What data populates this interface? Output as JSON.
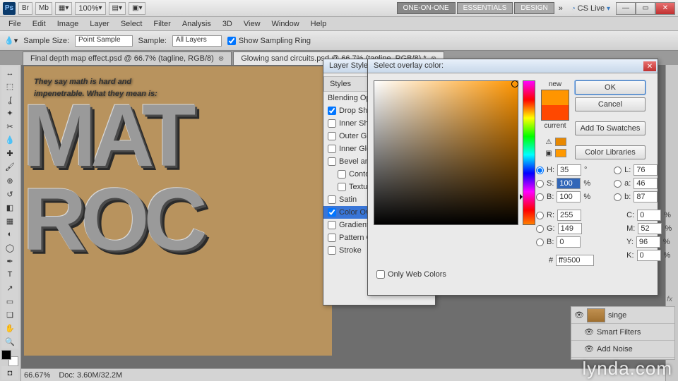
{
  "titlebar": {
    "zoom_display": "100%",
    "workspaces": [
      "ONE-ON-ONE",
      "ESSENTIALS",
      "DESIGN"
    ],
    "cslive": "CS Live"
  },
  "menu": [
    "File",
    "Edit",
    "Image",
    "Layer",
    "Select",
    "Filter",
    "Analysis",
    "3D",
    "View",
    "Window",
    "Help"
  ],
  "optionsbar": {
    "sample_size_label": "Sample Size:",
    "sample_size_value": "Point Sample",
    "sample_label": "Sample:",
    "sample_value": "All Layers",
    "show_ring_label": "Show Sampling Ring"
  },
  "tabs": [
    {
      "label": "Final depth map effect.psd @ 66.7% (tagline, RGB/8)",
      "active": false
    },
    {
      "label": "Glowing sand circuits.psd @ 66.7% (tagline, RGB/8) *",
      "active": true
    }
  ],
  "canvas": {
    "tagline_line1": "They say math is hard and",
    "tagline_line2": "impenetrable. What they mean is:",
    "big_row1": "MAT",
    "big_row2": "ROC"
  },
  "statusbar": {
    "zoom": "66.67%",
    "doc": "Doc: 3.60M/32.2M"
  },
  "layer_style": {
    "title": "Layer Style",
    "header": "Styles",
    "blending": "Blending Options",
    "items": [
      {
        "label": "Drop Shadow",
        "checked": true
      },
      {
        "label": "Inner Shadow",
        "checked": false
      },
      {
        "label": "Outer Glow",
        "checked": false
      },
      {
        "label": "Inner Glow",
        "checked": false
      },
      {
        "label": "Bevel and Emboss",
        "checked": false
      },
      {
        "label": "Contour",
        "checked": false,
        "sub": true
      },
      {
        "label": "Texture",
        "checked": false,
        "sub": true
      },
      {
        "label": "Satin",
        "checked": false
      },
      {
        "label": "Color Overlay",
        "checked": true,
        "selected": true
      },
      {
        "label": "Gradient Overlay",
        "checked": false
      },
      {
        "label": "Pattern Overlay",
        "checked": false
      },
      {
        "label": "Stroke",
        "checked": false
      }
    ]
  },
  "color_picker": {
    "title": "Select overlay color:",
    "new_label": "new",
    "current_label": "current",
    "buttons": {
      "ok": "OK",
      "cancel": "Cancel",
      "add": "Add To Swatches",
      "lib": "Color Libraries"
    },
    "web_only": "Only Web Colors",
    "H": {
      "label": "H:",
      "value": "35",
      "unit": "°"
    },
    "S": {
      "label": "S:",
      "value": "100",
      "unit": "%"
    },
    "B": {
      "label": "B:",
      "value": "100",
      "unit": "%"
    },
    "R": {
      "label": "R:",
      "value": "255"
    },
    "G": {
      "label": "G:",
      "value": "149"
    },
    "Bv": {
      "label": "B:",
      "value": "0"
    },
    "L": {
      "label": "L:",
      "value": "76"
    },
    "a": {
      "label": "a:",
      "value": "46"
    },
    "b": {
      "label": "b:",
      "value": "87"
    },
    "C": {
      "label": "C:",
      "value": "0",
      "unit": "%"
    },
    "M": {
      "label": "M:",
      "value": "52",
      "unit": "%"
    },
    "Y": {
      "label": "Y:",
      "value": "96",
      "unit": "%"
    },
    "K": {
      "label": "K:",
      "value": "0",
      "unit": "%"
    },
    "hex_label": "#",
    "hex": "ff9500",
    "new_color": "#ff9500",
    "current_color": "#ff4800"
  },
  "layers_panel": {
    "layer_name": "singe",
    "smart_filters": "Smart Filters",
    "add_noise": "Add Noise",
    "fx": "fx"
  },
  "watermark": "lynda.com"
}
